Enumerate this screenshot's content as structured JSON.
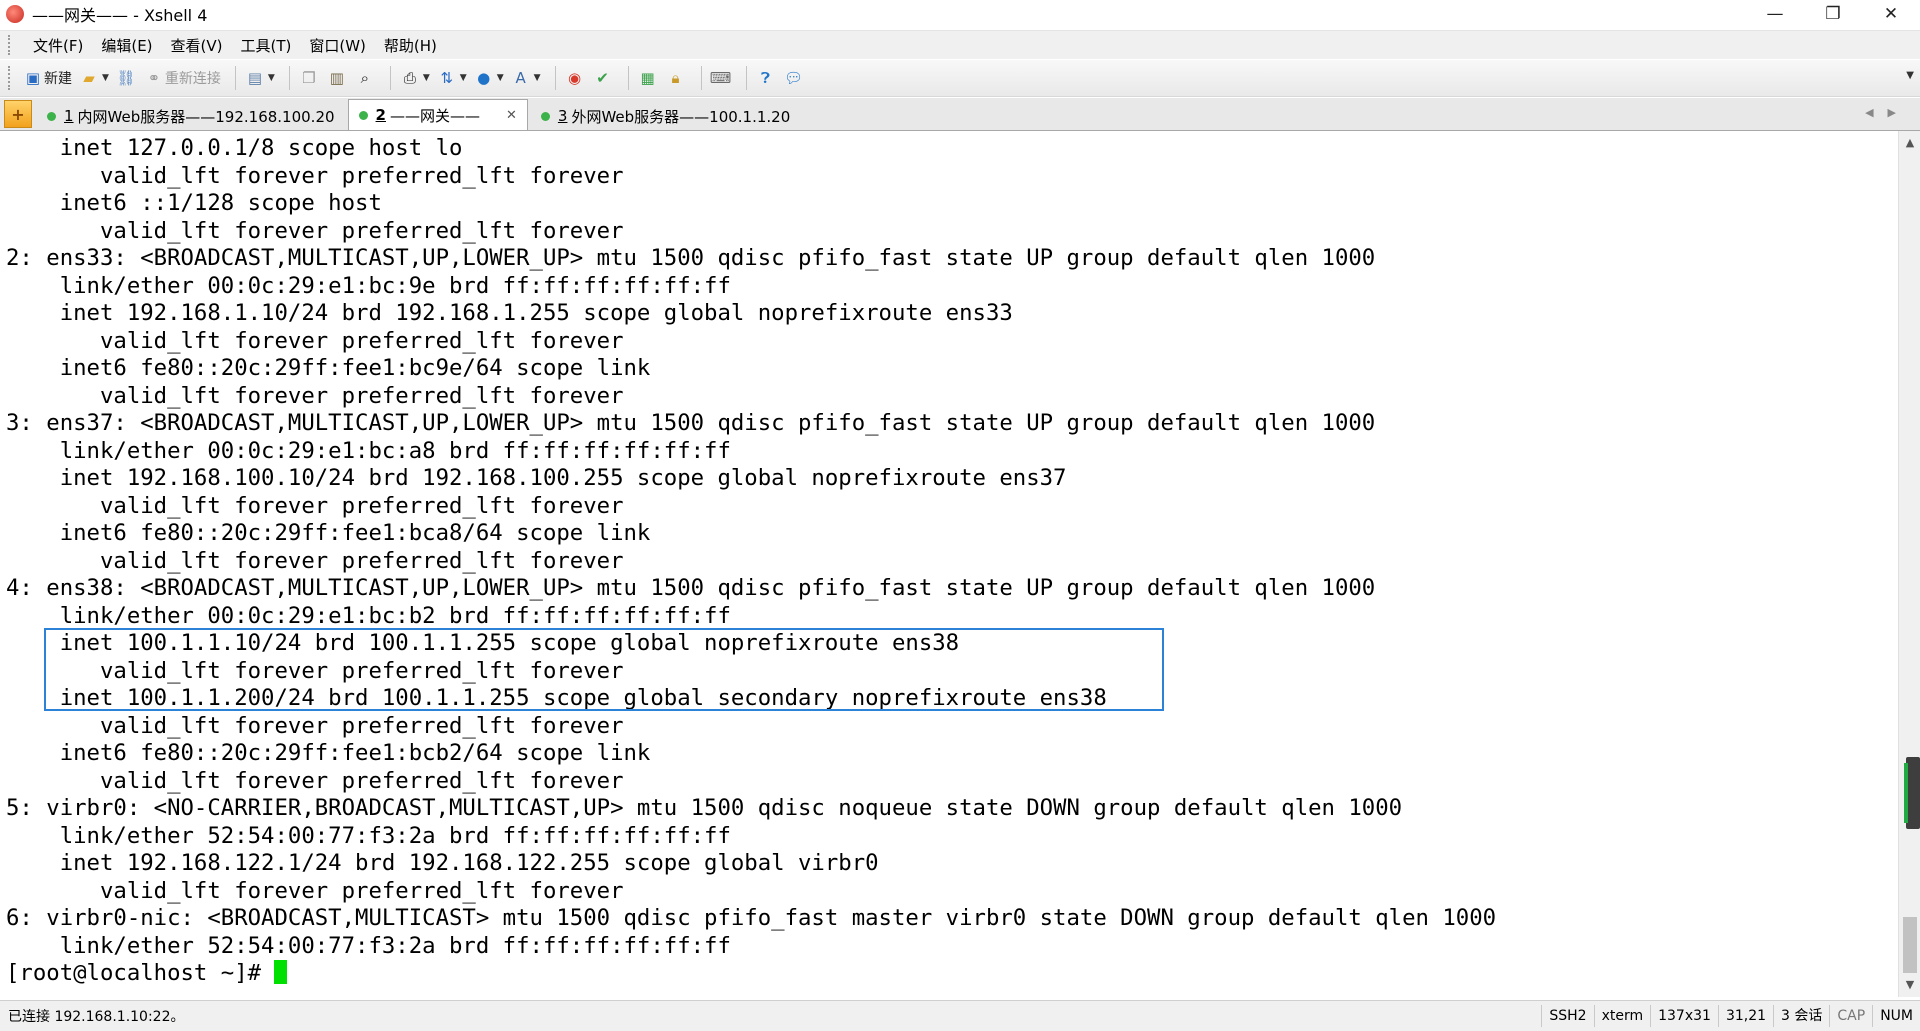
{
  "window": {
    "title": "——网关—— - Xshell 4",
    "minimize": "—",
    "restore": "❐",
    "close": "✕"
  },
  "menu": [
    "文件(F)",
    "编辑(E)",
    "查看(V)",
    "工具(T)",
    "窗口(W)",
    "帮助(H)"
  ],
  "toolbar": {
    "new_label": "新建",
    "reconnect_label": "重新连接"
  },
  "tabs": [
    {
      "num": "1",
      "label": "内网Web服务器——192.168.100.20",
      "active": false
    },
    {
      "num": "2",
      "label": "——网关——",
      "active": true
    },
    {
      "num": "3",
      "label": "外网Web服务器——100.1.1.20",
      "active": false
    }
  ],
  "terminal": {
    "lines": [
      "    inet 127.0.0.1/8 scope host lo",
      "       valid_lft forever preferred_lft forever",
      "    inet6 ::1/128 scope host",
      "       valid_lft forever preferred_lft forever",
      "2: ens33: <BROADCAST,MULTICAST,UP,LOWER_UP> mtu 1500 qdisc pfifo_fast state UP group default qlen 1000",
      "    link/ether 00:0c:29:e1:bc:9e brd ff:ff:ff:ff:ff:ff",
      "    inet 192.168.1.10/24 brd 192.168.1.255 scope global noprefixroute ens33",
      "       valid_lft forever preferred_lft forever",
      "    inet6 fe80::20c:29ff:fee1:bc9e/64 scope link",
      "       valid_lft forever preferred_lft forever",
      "3: ens37: <BROADCAST,MULTICAST,UP,LOWER_UP> mtu 1500 qdisc pfifo_fast state UP group default qlen 1000",
      "    link/ether 00:0c:29:e1:bc:a8 brd ff:ff:ff:ff:ff:ff",
      "    inet 192.168.100.10/24 brd 192.168.100.255 scope global noprefixroute ens37",
      "       valid_lft forever preferred_lft forever",
      "    inet6 fe80::20c:29ff:fee1:bca8/64 scope link",
      "       valid_lft forever preferred_lft forever",
      "4: ens38: <BROADCAST,MULTICAST,UP,LOWER_UP> mtu 1500 qdisc pfifo_fast state UP group default qlen 1000",
      "    link/ether 00:0c:29:e1:bc:b2 brd ff:ff:ff:ff:ff:ff",
      "    inet 100.1.1.10/24 brd 100.1.1.255 scope global noprefixroute ens38",
      "       valid_lft forever preferred_lft forever",
      "    inet 100.1.1.200/24 brd 100.1.1.255 scope global secondary noprefixroute ens38",
      "       valid_lft forever preferred_lft forever",
      "    inet6 fe80::20c:29ff:fee1:bcb2/64 scope link",
      "       valid_lft forever preferred_lft forever",
      "5: virbr0: <NO-CARRIER,BROADCAST,MULTICAST,UP> mtu 1500 qdisc noqueue state DOWN group default qlen 1000",
      "    link/ether 52:54:00:77:f3:2a brd ff:ff:ff:ff:ff:ff",
      "    inet 192.168.122.1/24 brd 192.168.122.255 scope global virbr0",
      "       valid_lft forever preferred_lft forever",
      "6: virbr0-nic: <BROADCAST,MULTICAST> mtu 1500 qdisc pfifo_fast master virbr0 state DOWN group default qlen 1000",
      "    link/ether 52:54:00:77:f3:2a brd ff:ff:ff:ff:ff:ff"
    ],
    "prompt": "[root@localhost ~]# ",
    "cursor_color": "#00e000",
    "highlight_color": "#2c82d6"
  },
  "status": {
    "connection": "已连接 192.168.1.10:22。",
    "protocol": "SSH2",
    "term": "xterm",
    "size": "137x31",
    "pos": "31,21",
    "sessions": "3 会话",
    "cap": "CAP",
    "num": "NUM"
  }
}
